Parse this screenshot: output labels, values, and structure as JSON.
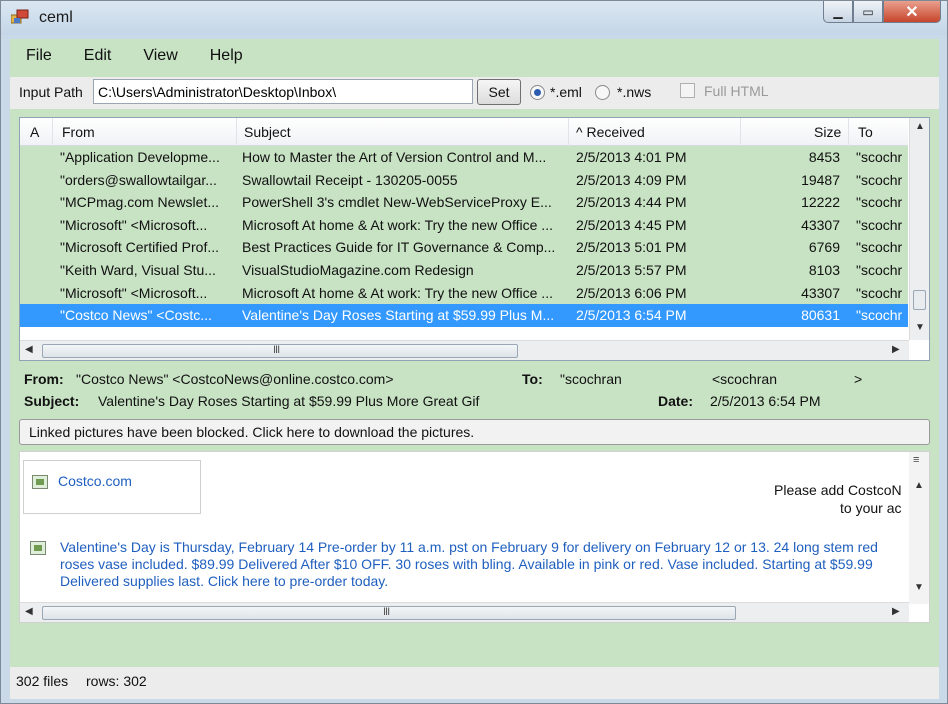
{
  "window": {
    "title": "ceml",
    "minimize": "▁",
    "maximize": "▭",
    "close": "✕"
  },
  "menu": [
    "File",
    "Edit",
    "View",
    "Help"
  ],
  "toolbar": {
    "input_label": "Input Path",
    "path_value": "C:\\Users\\Administrator\\Desktop\\Inbox\\",
    "set_label": "Set",
    "radio_eml": "*.eml",
    "radio_nws": "*.nws",
    "full_html": "Full HTML",
    "selected_radio": "eml"
  },
  "list": {
    "columns": {
      "a": "A",
      "from": "From",
      "subject": "Subject",
      "received": "^ Received",
      "size": "Size",
      "to": "To"
    },
    "rows": [
      {
        "from": "\"Application Developme...",
        "subject": "How to Master the Art of Version Control and M...",
        "received": "2/5/2013 4:01 PM",
        "size": "8453",
        "to": "\"scochr"
      },
      {
        "from": "\"orders@swallowtailgar...",
        "subject": "Swallowtail Receipt - 130205-0055",
        "received": "2/5/2013 4:09 PM",
        "size": "19487",
        "to": "\"scochr"
      },
      {
        "from": "\"MCPmag.com Newslet...",
        "subject": "PowerShell 3's cmdlet New-WebServiceProxy E...",
        "received": "2/5/2013 4:44 PM",
        "size": "12222",
        "to": "\"scochr"
      },
      {
        "from": "\"Microsoft\" <Microsoft...",
        "subject": "Microsoft At home & At work: Try the new Office ...",
        "received": "2/5/2013 4:45 PM",
        "size": "43307",
        "to": "\"scochr"
      },
      {
        "from": "\"Microsoft Certified Prof...",
        "subject": "Best Practices Guide for IT Governance & Comp...",
        "received": "2/5/2013 5:01 PM",
        "size": "6769",
        "to": "\"scochr"
      },
      {
        "from": "\"Keith Ward, Visual Stu...",
        "subject": "VisualStudioMagazine.com Redesign",
        "received": "2/5/2013 5:57 PM",
        "size": "8103",
        "to": "\"scochr"
      },
      {
        "from": "\"Microsoft\" <Microsoft...",
        "subject": "Microsoft At home & At work: Try the new Office ...",
        "received": "2/5/2013 6:06 PM",
        "size": "43307",
        "to": "\"scochr"
      },
      {
        "from": "\"Costco News\" <Costc...",
        "subject": "Valentine's Day Roses Starting at $59.99 Plus M...",
        "received": "2/5/2013 6:54 PM",
        "size": "80631",
        "to": "\"scochr",
        "selected": true
      }
    ],
    "hscroll_grip": "III"
  },
  "details": {
    "from_label": "From:",
    "from_value": "\"Costco News\" <CostcoNews@online.costco.com>",
    "to_label": "To:",
    "to_value": "\"scochran",
    "to_addr": "<scochran",
    "to_more": ">",
    "subject_label": "Subject:",
    "subject_value": "Valentine's Day Roses Starting at $59.99 Plus More Great Gif",
    "date_label": "Date:",
    "date_value": "2/5/2013 6:54 PM"
  },
  "notice": "Linked pictures have been blocked.   Click here to download the pictures.",
  "browser": {
    "link_text": "Costco.com",
    "right_line1": "Please add CostcoN",
    "right_line2": "to your ac",
    "promo": "Valentine's Day is Thursday, February 14 Pre-order by 11 a.m. pst on February 9 for delivery on February 12 or 13. 24 long stem red roses vase included. $89.99 Delivered After $10 OFF. 30 roses with bling. Available in pink or red. Vase included. Starting at $59.99 Delivered supplies last. Click here to pre-order today.",
    "hscroll_grip": "III"
  },
  "status": {
    "files": "302 files",
    "rows": "rows: 302"
  }
}
